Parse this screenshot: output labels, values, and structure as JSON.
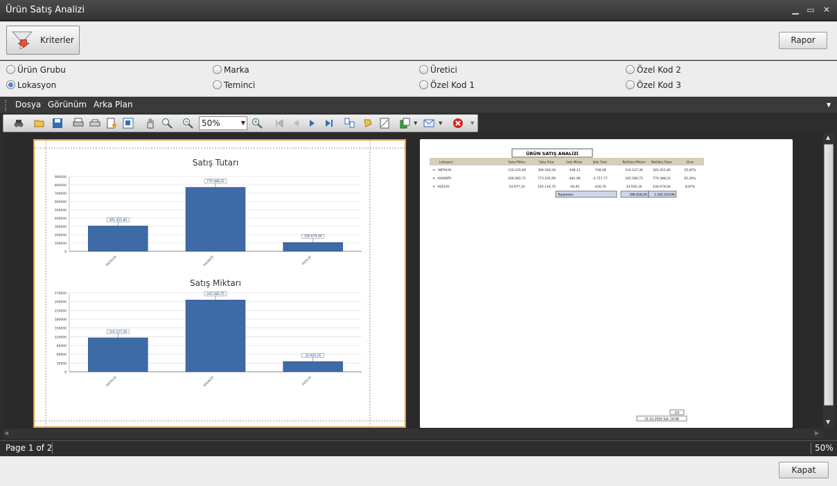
{
  "window": {
    "title": "Ürün Satış Analizi"
  },
  "top": {
    "kriterler": "Kriterler",
    "rapor": "Rapor"
  },
  "radios": [
    {
      "label": "Ürün Grubu",
      "selected": false
    },
    {
      "label": "Marka",
      "selected": false
    },
    {
      "label": "Üretici",
      "selected": false
    },
    {
      "label": "Özel Kod 2",
      "selected": false
    },
    {
      "label": "Lokasyon",
      "selected": true
    },
    {
      "label": "Teminci",
      "selected": false
    },
    {
      "label": "Özel Kod 1",
      "selected": false
    },
    {
      "label": "Özel Kod 3",
      "selected": false
    }
  ],
  "menu": {
    "dosya": "Dosya",
    "gorunum": "Görünüm",
    "arka_plan": "Arka Plan"
  },
  "toolbar": {
    "zoom": "50%"
  },
  "status": {
    "page": "Page 1 of 2",
    "zoom": "50%"
  },
  "bottom": {
    "kapat": "Kapat"
  },
  "chart_data": [
    {
      "type": "bar",
      "title": "Satış Tutarı",
      "categories": [
        "ANTALYA",
        "KADIKÖY",
        "KIZILAY"
      ],
      "values": [
        305451.8,
        770388.22,
        106679.94
      ],
      "data_labels": [
        "305.451,80",
        "770.388,22",
        "106.679,94"
      ],
      "yticks": [
        "900000",
        "800000",
        "700000",
        "600000",
        "500000",
        "400000",
        "300000",
        "200000",
        "100000",
        "0"
      ],
      "ylim": [
        0,
        900000
      ],
      "grid": true,
      "color": "#3e6aa6"
    },
    {
      "type": "bar",
      "title": "Satış Miktarı",
      "categories": [
        "ANTALYA",
        "KADIKÖY",
        "KIZILAY"
      ],
      "values": [
        116127.36,
        245580.75,
        34920.16
      ],
      "data_labels": [
        "116.127,36",
        "245.580,75",
        "34.920,16"
      ],
      "yticks": [
        "270000",
        "240000",
        "210000",
        "180000",
        "150000",
        "120000",
        "90000",
        "60000",
        "30000",
        "0"
      ],
      "ylim": [
        0,
        270000
      ],
      "grid": true,
      "color": "#3e6aa6"
    }
  ],
  "report": {
    "title": "ÜRÜN SATIŞ ANALİZİ",
    "columns": [
      "Lokasyon",
      "Satış Miktar",
      "Satış Tutar",
      "İade Miktar",
      "İade Tutar",
      "NetSatış Miktarı",
      "NetSatış Tutarı",
      "Oran"
    ],
    "rows": [
      [
        "ANTALYA",
        "116.235,69",
        "306.160,28",
        "-108,11",
        "-708,48",
        "116.127,36",
        "305.451,80",
        "25,87%"
      ],
      [
        "KADIKÖY",
        "246.062,71",
        "773.105,99",
        "-481,96",
        "-2.717,77",
        "245.580,75",
        "770.388,22",
        "65,26%"
      ],
      [
        "KIZILAY",
        "34.977,10",
        "105.116,70",
        "-56,95",
        "-436,76",
        "34.920,16",
        "106.679,94",
        "8,87%"
      ]
    ],
    "totals_label": "Toplamlar:",
    "totals": [
      "396.628,26",
      "1.182.519,96"
    ],
    "footer_page": "2/2",
    "footer_date": "31.10.2016 Salı 14:08"
  }
}
